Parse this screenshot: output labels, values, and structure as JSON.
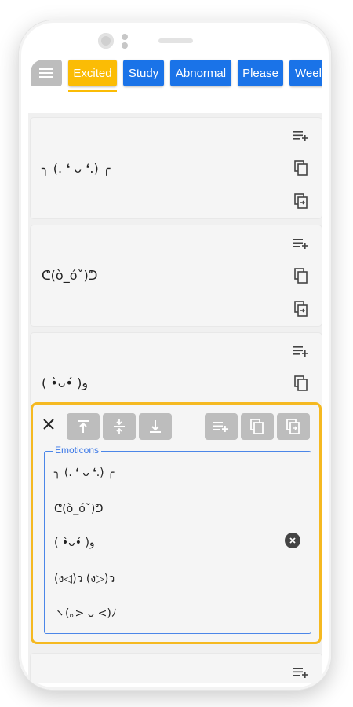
{
  "tabs": [
    {
      "label": "Excited",
      "active": true
    },
    {
      "label": "Study",
      "active": false
    },
    {
      "label": "Abnormal",
      "active": false
    },
    {
      "label": "Please",
      "active": false
    },
    {
      "label": "Weel",
      "active": false
    }
  ],
  "cards": [
    {
      "emoticon": "╮ (. ❛ ᴗ ❛.) ╭"
    },
    {
      "emoticon": "ᕦ(ò_óˇ)ᕤ"
    },
    {
      "emoticon": "( •̀ᴗ•́ )و"
    }
  ],
  "editor": {
    "field_label": "Emoticons",
    "lines": [
      "╮ (. ❛ ᴗ ❛.) ╭",
      "ᕦ(ò_óˇ)ᕤ",
      "( •̀ᴗ•́ )و",
      "(ง◁)ว (ง▷)ว",
      "ヽ(｡> ᴗ <)ﾉ"
    ]
  },
  "icons": {
    "menu": "menu-icon",
    "add_to_list": "playlist-add-icon",
    "copy": "copy-icon",
    "share": "open-in-icon",
    "close": "close-icon",
    "move_top": "align-top-icon",
    "move_middle": "align-middle-icon",
    "move_bottom": "align-bottom-icon",
    "clear": "clear-icon"
  },
  "colors": {
    "tab": "#1a73e8",
    "tab_active": "#fbbc05",
    "editor_border": "#f5b921",
    "field_border": "#4b86e8",
    "button_disabled": "#bdbdbd"
  }
}
